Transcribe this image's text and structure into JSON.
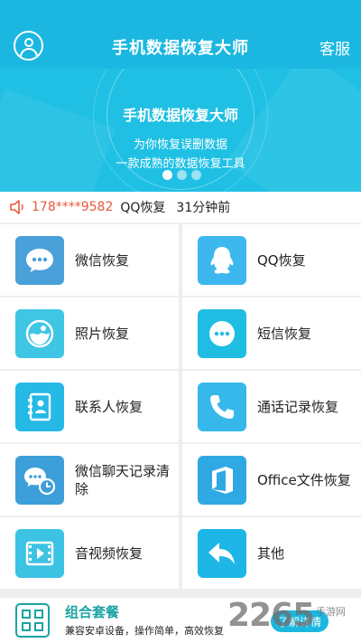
{
  "header": {
    "title": "手机数据恢复大师",
    "service_label": "客服"
  },
  "banner": {
    "title": "手机数据恢复大师",
    "subtitle_line1": "为你恢复误删数据",
    "subtitle_line2": "一款成熟的数据恢复工具",
    "slide_count": 3,
    "active_slide": 1
  },
  "ticker": {
    "phone": "178****9582",
    "action": "QQ恢复",
    "time": "31分钟前"
  },
  "features": [
    {
      "label": "微信恢复",
      "icon": "wechat-icon",
      "color": "#4aa0d8"
    },
    {
      "label": "QQ恢复",
      "icon": "qq-icon",
      "color": "#3cb8ee"
    },
    {
      "label": "照片恢复",
      "icon": "photo-icon",
      "color": "#3ec6e4"
    },
    {
      "label": "短信恢复",
      "icon": "sms-icon",
      "color": "#1fbde2"
    },
    {
      "label": "联系人恢复",
      "icon": "contacts-icon",
      "color": "#25b9e6"
    },
    {
      "label": "通话记录恢复",
      "icon": "call-log-icon",
      "color": "#36b9ea"
    },
    {
      "label": "微信聊天记录清除",
      "icon": "wechat-clean-icon",
      "color": "#3d9fd9"
    },
    {
      "label": "Office文件恢复",
      "icon": "office-icon",
      "color": "#2fa9e3"
    },
    {
      "label": "音视频恢复",
      "icon": "video-icon",
      "color": "#3cc3e4"
    },
    {
      "label": "其他",
      "icon": "other-icon",
      "color": "#1db6e6"
    }
  ],
  "bottom": {
    "title": "组合套餐",
    "subtitle": "兼容安卓设备，操作简单，高效恢复",
    "button_label": "了解详情"
  },
  "watermark": {
    "text": "2265",
    "sub": "手游网"
  }
}
